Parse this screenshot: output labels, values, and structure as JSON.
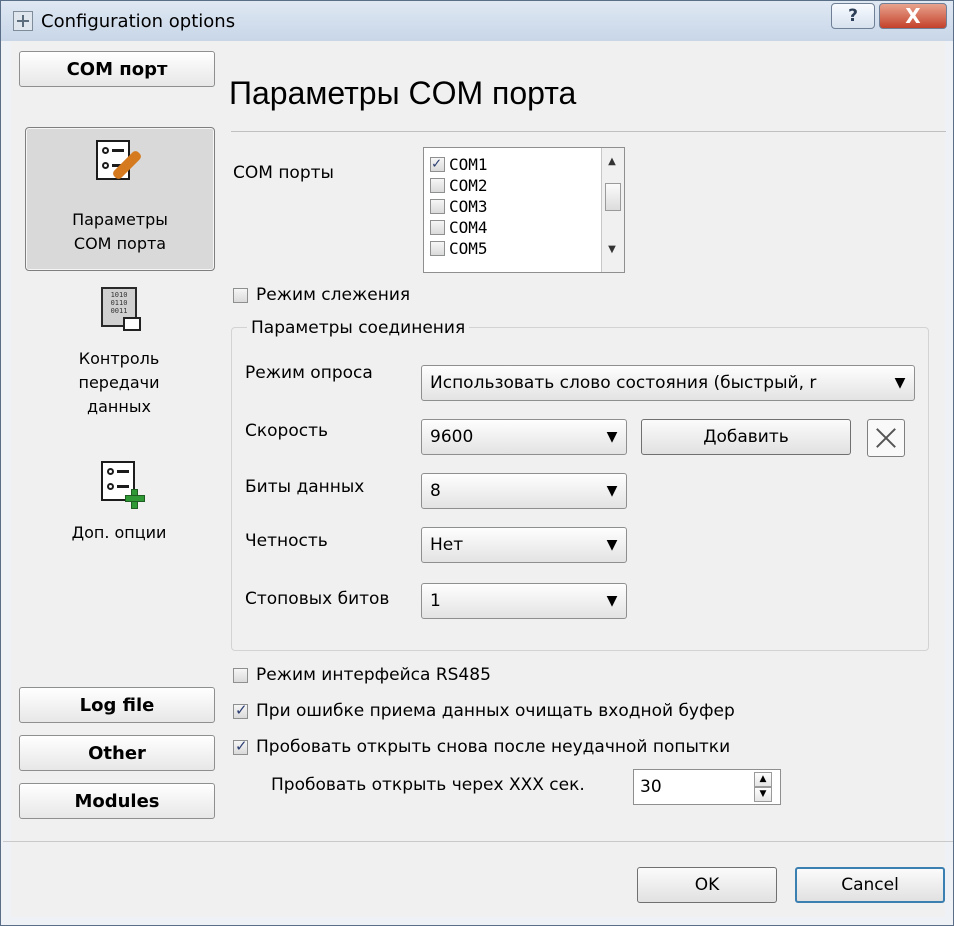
{
  "window": {
    "title": "Configuration options",
    "help": "?",
    "close": "X"
  },
  "sidebar": {
    "com_port": "COM порт",
    "items": [
      {
        "label": "Параметры\nCOM порта",
        "icon": "settings-wrench-icon",
        "active": true
      },
      {
        "label": "Контроль\nпередачи\nданных",
        "icon": "binary-data-icon",
        "active": false
      },
      {
        "label": "Доп. опции",
        "icon": "document-plus-icon",
        "active": false
      }
    ],
    "log_file": "Log file",
    "other": "Other",
    "modules": "Modules"
  },
  "main": {
    "title": "Параметры COM порта",
    "com_ports_label": "COM порты",
    "com_ports": [
      {
        "name": "COM1",
        "checked": true
      },
      {
        "name": "COM2",
        "checked": false
      },
      {
        "name": "COM3",
        "checked": false
      },
      {
        "name": "COM4",
        "checked": false
      },
      {
        "name": "COM5",
        "checked": false
      }
    ],
    "tracking_mode": "Режим слежения",
    "connection_group": "Параметры соединения",
    "poll_mode_label": "Режим опроса",
    "poll_mode_value": "Использовать слово состояния (быстрый, r",
    "speed_label": "Скорость",
    "speed_value": "9600",
    "add_button": "Добавить",
    "data_bits_label": "Биты данных",
    "data_bits_value": "8",
    "parity_label": "Четность",
    "parity_value": "Нет",
    "stop_bits_label": "Стоповых битов",
    "stop_bits_value": "1",
    "rs485": "Режим интерфейса RS485",
    "clear_buffer": "При ошибке приема данных очищать входной буфер",
    "retry_open": "Пробовать открыть снова после неудачной попытки",
    "retry_label": "Пробовать открыть черех XXX сек.",
    "retry_value": "30"
  },
  "footer": {
    "ok": "OK",
    "cancel": "Cancel"
  }
}
